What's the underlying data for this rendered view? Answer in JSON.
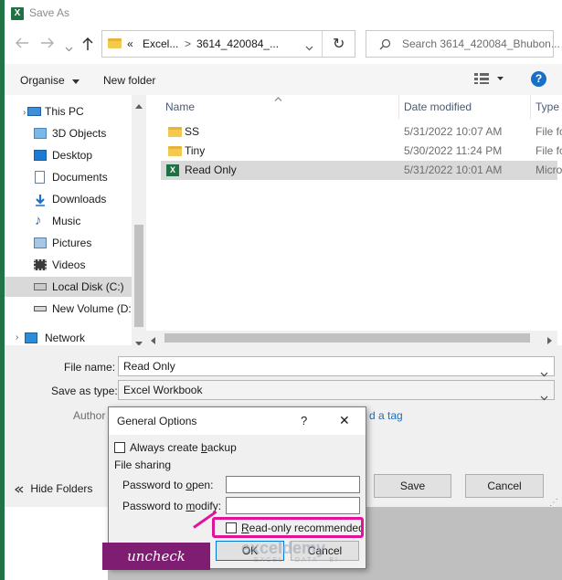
{
  "window": {
    "title": "Save As",
    "app_icon_letter": "X"
  },
  "nav": {
    "back_icon": "back-arrow-icon",
    "forward_icon": "forward-arrow-icon",
    "up_icon": "up-arrow-icon"
  },
  "address": {
    "chevron": "«",
    "crumb1": "Excel...",
    "sep": ">",
    "crumb2": "3614_420084_...",
    "dropdown_icon": "chevron-down-icon",
    "refresh_glyph": "↻"
  },
  "search": {
    "placeholder": "Search 3614_420084_Bhubon..."
  },
  "toolbar": {
    "organise_label": "Organise",
    "new_folder_label": "New folder",
    "help_label": "?"
  },
  "sidebar": {
    "items": [
      {
        "label": "This PC",
        "icon": "pc-icon"
      },
      {
        "label": "3D Objects",
        "icon": "3d-objects-icon"
      },
      {
        "label": "Desktop",
        "icon": "desktop-icon"
      },
      {
        "label": "Documents",
        "icon": "documents-icon"
      },
      {
        "label": "Downloads",
        "icon": "downloads-icon"
      },
      {
        "label": "Music",
        "icon": "music-icon"
      },
      {
        "label": "Pictures",
        "icon": "pictures-icon"
      },
      {
        "label": "Videos",
        "icon": "videos-icon"
      },
      {
        "label": "Local Disk (C:)",
        "icon": "local-disk-icon"
      },
      {
        "label": "New Volume (D:",
        "icon": "drive-icon"
      },
      {
        "label": "Network",
        "icon": "network-icon"
      }
    ]
  },
  "filelist": {
    "columns": {
      "name": "Name",
      "date": "Date modified",
      "type": "Type"
    },
    "rows": [
      {
        "name": "SS",
        "date": "5/31/2022 10:07 AM",
        "type": "File fo",
        "icon": "folder-icon"
      },
      {
        "name": "Tiny",
        "date": "5/30/2022 11:24 PM",
        "type": "File fo",
        "icon": "folder-icon"
      },
      {
        "name": "Read Only",
        "date": "5/31/2022 10:01 AM",
        "type": "Micro",
        "icon": "excel-file-icon"
      }
    ]
  },
  "form": {
    "filename_label": "File name:",
    "filename_value": "Read Only",
    "savetype_label": "Save as type:",
    "savetype_value": "Excel Workbook",
    "authors_label": "Author",
    "tags_link": "d a tag"
  },
  "footer": {
    "hide_folders_label": "Hide Folders",
    "save_label": "Save",
    "cancel_label": "Cancel"
  },
  "dialog": {
    "title": "General Options",
    "help": "?",
    "close": "✕",
    "backup_label_pre": "Always create ",
    "backup_label_acc": "b",
    "backup_label_post": "ackup",
    "backup_checked": false,
    "file_sharing": "File sharing",
    "pw_open_pre": "Password to ",
    "pw_open_acc": "o",
    "pw_open_post": "pen:",
    "pw_modify_pre": "Password to ",
    "pw_modify_acc": "m",
    "pw_modify_post": "odify:",
    "readonly_acc": "R",
    "readonly_post": "ead-only recommended",
    "readonly_checked": false,
    "ok_label": "OK",
    "cancel_label": "Cancel"
  },
  "annotation": {
    "callout_text": "uncheck",
    "highlight_color": "#e0149b",
    "callout_color": "#7e1d72"
  },
  "watermark": {
    "brand": "exceldemy",
    "tagline": "EXCEL · DATA · BI"
  }
}
